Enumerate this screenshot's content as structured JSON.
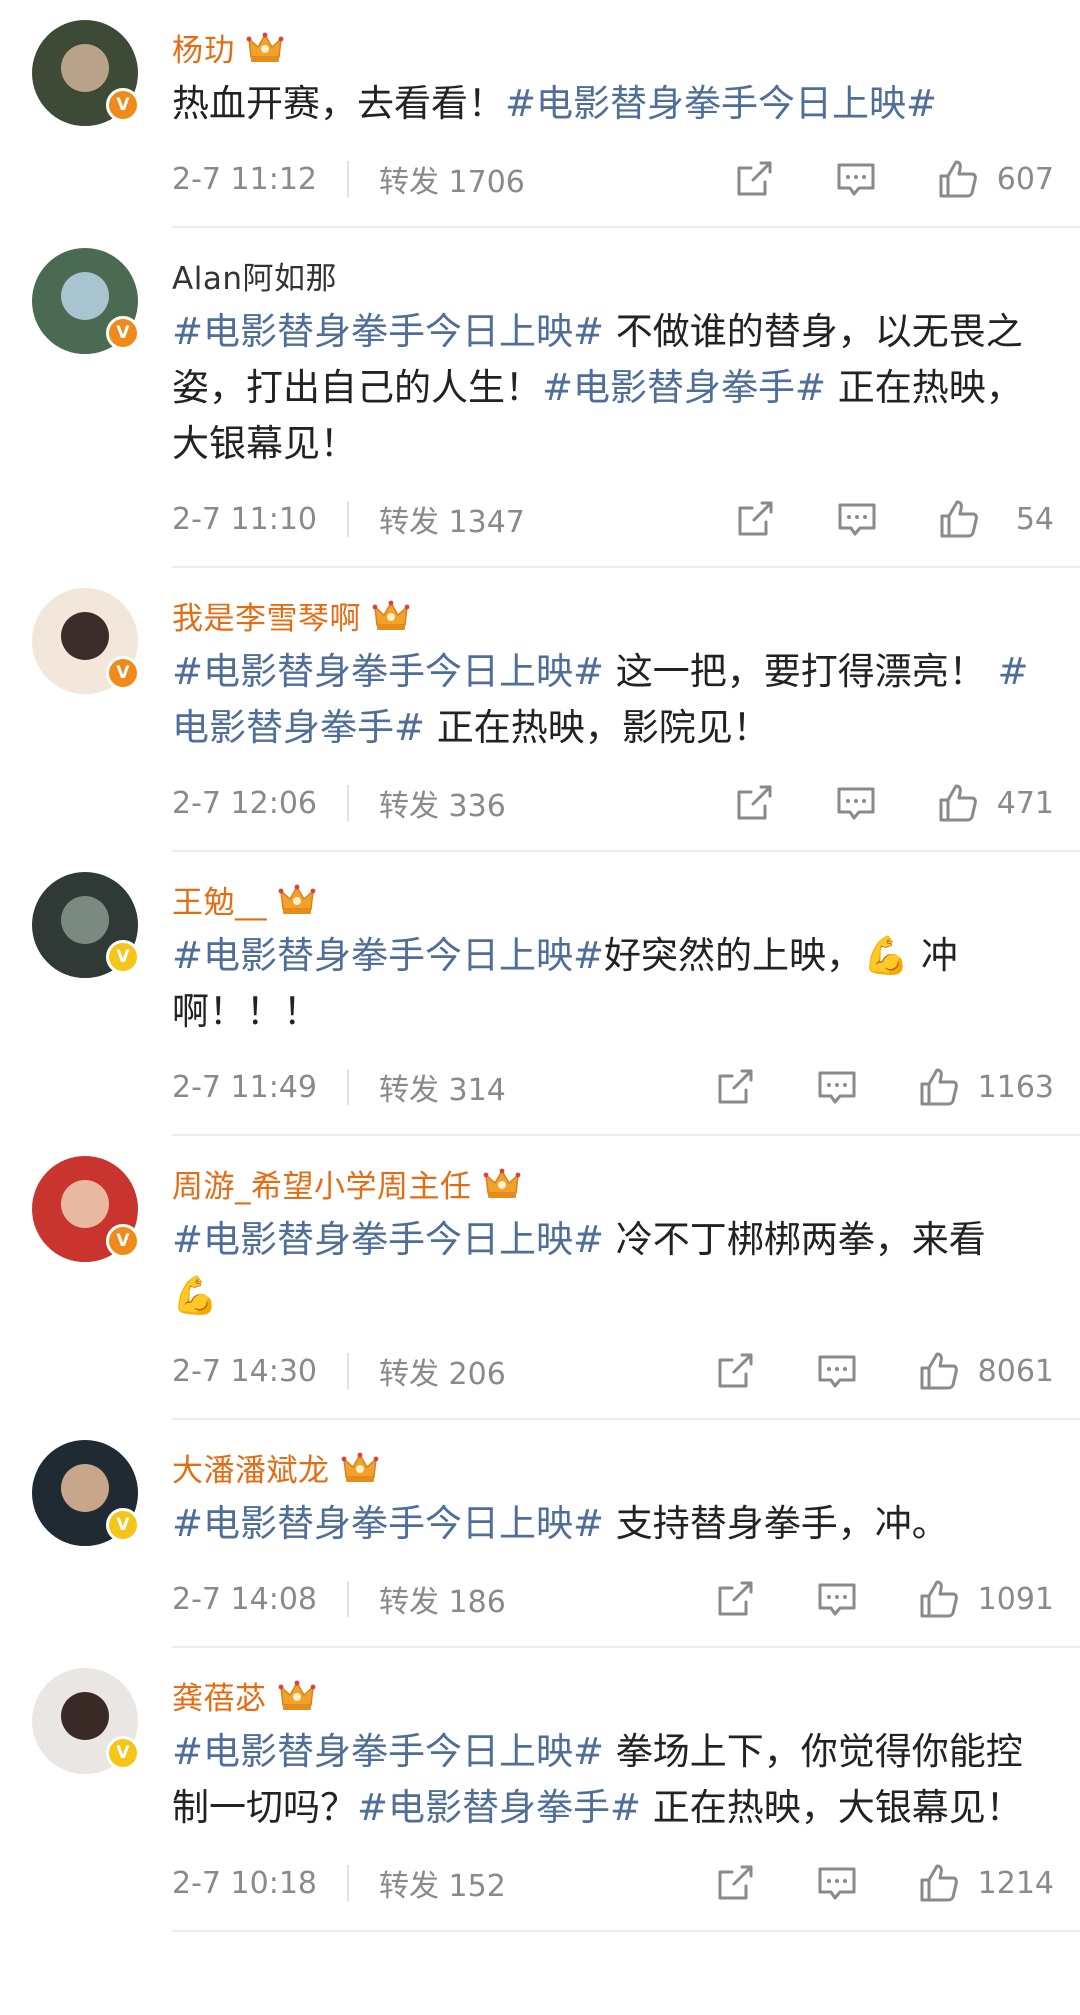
{
  "posts": [
    {
      "name": "杨玏",
      "name_style": "vip",
      "crown": "crown-icon",
      "verify": "orange",
      "avatar_colors": [
        "#3c4a36",
        "#b8a38a"
      ],
      "parts": [
        {
          "type": "text",
          "text": "热血开赛，去看看！"
        },
        {
          "type": "tag",
          "text": "#电影替身拳手今日上映#"
        }
      ],
      "time": "2-7 11:12",
      "repost": "转发 1706",
      "likes": "607"
    },
    {
      "name": "Alan阿如那",
      "name_style": "plain",
      "crown": "",
      "verify": "orange",
      "avatar_colors": [
        "#4a6b52",
        "#a8c4cf"
      ],
      "parts": [
        {
          "type": "tag",
          "text": "#电影替身拳手今日上映#"
        },
        {
          "type": "text",
          "text": " 不做谁的替身，以无畏之姿，打出自己的人生！"
        },
        {
          "type": "tag",
          "text": "#电影替身拳手#"
        },
        {
          "type": "text",
          "text": " 正在热映，大银幕见！"
        }
      ],
      "time": "2-7 11:10",
      "repost": "转发 1347",
      "likes": "54"
    },
    {
      "name": "我是李雪琴啊",
      "name_style": "vip",
      "crown": "crown-icon",
      "verify": "orange",
      "avatar_colors": [
        "#f3e6da",
        "#3b2e2a"
      ],
      "parts": [
        {
          "type": "tag",
          "text": "#电影替身拳手今日上映#"
        },
        {
          "type": "text",
          "text": " 这一把，要打得漂亮！ "
        },
        {
          "type": "tag",
          "text": "#电影替身拳手#"
        },
        {
          "type": "text",
          "text": " 正在热映，影院见！"
        }
      ],
      "time": "2-7 12:06",
      "repost": "转发 336",
      "likes": "471"
    },
    {
      "name": "王勉__",
      "name_style": "vip",
      "crown": "crown-icon",
      "verify": "gold",
      "avatar_colors": [
        "#2f3a36",
        "#7b8a80"
      ],
      "parts": [
        {
          "type": "tag",
          "text": "#电影替身拳手今日上映#"
        },
        {
          "type": "text",
          "text": "好突然的上映，💪 冲啊！！！"
        }
      ],
      "time": "2-7 11:49",
      "repost": "转发 314",
      "likes": "1163"
    },
    {
      "name": "周游_希望小学周主任",
      "name_style": "vip",
      "crown": "crown-icon",
      "verify": "orange",
      "avatar_colors": [
        "#c9352e",
        "#e8b9a0"
      ],
      "parts": [
        {
          "type": "tag",
          "text": "#电影替身拳手今日上映#"
        },
        {
          "type": "text",
          "text": " 冷不丁梆梆两拳，来看💪"
        }
      ],
      "time": "2-7 14:30",
      "repost": "转发 206",
      "likes": "8061"
    },
    {
      "name": "大潘潘斌龙",
      "name_style": "vip",
      "crown": "crown-icon",
      "verify": "gold",
      "avatar_colors": [
        "#1f2a33",
        "#c8a68a"
      ],
      "parts": [
        {
          "type": "tag",
          "text": "#电影替身拳手今日上映#"
        },
        {
          "type": "text",
          "text": " 支持替身拳手，冲。"
        }
      ],
      "time": "2-7 14:08",
      "repost": "转发 186",
      "likes": "1091"
    },
    {
      "name": "龚蓓苾",
      "name_style": "vip",
      "crown": "crown-icon",
      "verify": "gold",
      "avatar_colors": [
        "#e9e6e4",
        "#3a2a26"
      ],
      "parts": [
        {
          "type": "tag",
          "text": "#电影替身拳手今日上映#"
        },
        {
          "type": "text",
          "text": " 拳场上下，你觉得你能控制一切吗？"
        },
        {
          "type": "tag",
          "text": "#电影替身拳手#"
        },
        {
          "type": "text",
          "text": " 正在热映，大银幕见！"
        }
      ],
      "time": "2-7 10:18",
      "repost": "转发 152",
      "likes": "1214"
    }
  ],
  "icons": {
    "share": "share-icon",
    "comment": "comment-icon",
    "like": "thumbs-up-icon",
    "verify": "verified-badge-icon"
  },
  "colors": {
    "name_vip": "#e46d14",
    "hashtag": "#4f6e99",
    "meta": "#8a8a8a"
  }
}
